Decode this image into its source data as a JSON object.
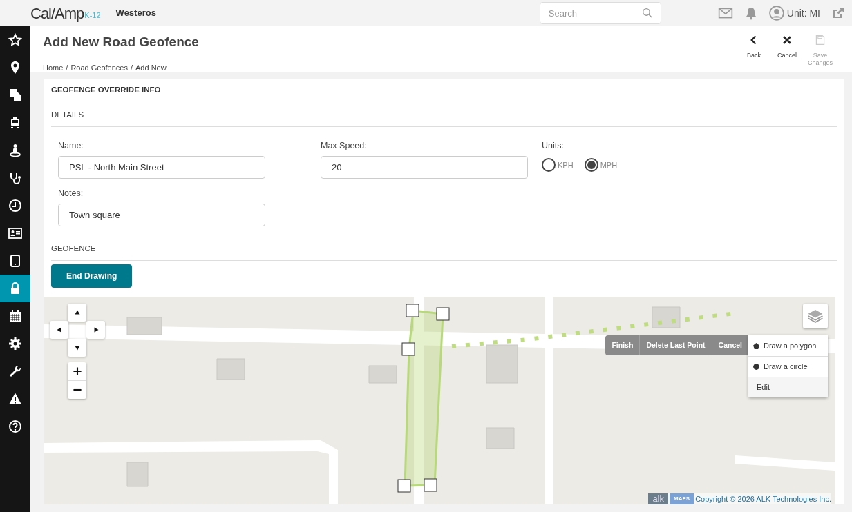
{
  "header": {
    "logo": "Cal/Amp",
    "logo_badge": "K-12",
    "org": "Westeros",
    "search": {
      "placeholder": "Search"
    },
    "user": "Unit: MI"
  },
  "sidebar": {
    "items": [
      {
        "kind": "star",
        "selected": false
      },
      {
        "kind": "pin",
        "selected": false
      },
      {
        "kind": "docs",
        "selected": false
      },
      {
        "kind": "bus",
        "selected": false
      },
      {
        "kind": "person",
        "selected": false
      },
      {
        "kind": "stethoscope",
        "selected": false
      },
      {
        "kind": "clock",
        "selected": false
      },
      {
        "kind": "card",
        "selected": false
      },
      {
        "kind": "tablet",
        "selected": false
      },
      {
        "kind": "lock",
        "selected": true
      },
      {
        "kind": "calendar",
        "selected": false
      },
      {
        "kind": "gear",
        "selected": false
      },
      {
        "kind": "wrench",
        "selected": false
      },
      {
        "kind": "warning",
        "selected": false
      },
      {
        "kind": "help",
        "selected": false
      }
    ]
  },
  "page": {
    "title": "Add New Road Geofence",
    "breadcrumb": [
      "Home",
      "/",
      "Road Geofences",
      "/",
      "Add New"
    ],
    "actions": [
      {
        "kind": "back",
        "label": "Back",
        "disabled": false
      },
      {
        "kind": "cancel",
        "label": "Cancel",
        "disabled": false
      },
      {
        "kind": "save",
        "label": "Save Changes",
        "disabled": true
      }
    ]
  },
  "form": {
    "title": "GEOFENCE OVERRIDE INFO",
    "details_heading": "DETAILS",
    "name": {
      "label": "Name:",
      "value": "PSL - North Main Street"
    },
    "max_speed": {
      "label": "Max Speed:",
      "value": "20"
    },
    "units": {
      "label": "Units:",
      "options": [
        {
          "label": "KPH",
          "selected": false
        },
        {
          "label": "MPH",
          "selected": true
        }
      ]
    },
    "notes": {
      "label": "Notes:",
      "value": "Town square"
    },
    "geofence_heading": "GEOFENCE",
    "end_button": "End Drawing"
  },
  "map": {
    "kind": "picture",
    "draw_toolbar": [
      "Finish",
      "Delete Last Point",
      "Cancel"
    ],
    "draw_menu": [
      {
        "kind": "polygon",
        "label": "Draw a polygon"
      },
      {
        "kind": "circle",
        "label": "Draw a circle"
      },
      {
        "kind": "plain",
        "label": "Edit"
      }
    ],
    "attribution": {
      "logo": "alk",
      "logo_badge": "MAPS",
      "copyright": "Copyright © 2026 ALK Technologies Inc."
    }
  }
}
